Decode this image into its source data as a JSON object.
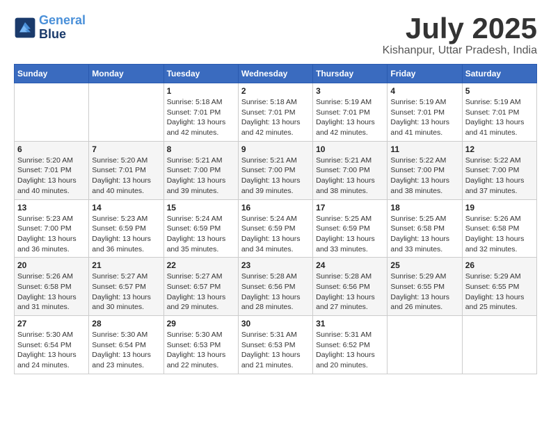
{
  "header": {
    "logo_line1": "General",
    "logo_line2": "Blue",
    "month_year": "July 2025",
    "location": "Kishanpur, Uttar Pradesh, India"
  },
  "days_of_week": [
    "Sunday",
    "Monday",
    "Tuesday",
    "Wednesday",
    "Thursday",
    "Friday",
    "Saturday"
  ],
  "weeks": [
    [
      {
        "day": "",
        "info": ""
      },
      {
        "day": "",
        "info": ""
      },
      {
        "day": "1",
        "info": "Sunrise: 5:18 AM\nSunset: 7:01 PM\nDaylight: 13 hours and 42 minutes."
      },
      {
        "day": "2",
        "info": "Sunrise: 5:18 AM\nSunset: 7:01 PM\nDaylight: 13 hours and 42 minutes."
      },
      {
        "day": "3",
        "info": "Sunrise: 5:19 AM\nSunset: 7:01 PM\nDaylight: 13 hours and 42 minutes."
      },
      {
        "day": "4",
        "info": "Sunrise: 5:19 AM\nSunset: 7:01 PM\nDaylight: 13 hours and 41 minutes."
      },
      {
        "day": "5",
        "info": "Sunrise: 5:19 AM\nSunset: 7:01 PM\nDaylight: 13 hours and 41 minutes."
      }
    ],
    [
      {
        "day": "6",
        "info": "Sunrise: 5:20 AM\nSunset: 7:01 PM\nDaylight: 13 hours and 40 minutes."
      },
      {
        "day": "7",
        "info": "Sunrise: 5:20 AM\nSunset: 7:01 PM\nDaylight: 13 hours and 40 minutes."
      },
      {
        "day": "8",
        "info": "Sunrise: 5:21 AM\nSunset: 7:00 PM\nDaylight: 13 hours and 39 minutes."
      },
      {
        "day": "9",
        "info": "Sunrise: 5:21 AM\nSunset: 7:00 PM\nDaylight: 13 hours and 39 minutes."
      },
      {
        "day": "10",
        "info": "Sunrise: 5:21 AM\nSunset: 7:00 PM\nDaylight: 13 hours and 38 minutes."
      },
      {
        "day": "11",
        "info": "Sunrise: 5:22 AM\nSunset: 7:00 PM\nDaylight: 13 hours and 38 minutes."
      },
      {
        "day": "12",
        "info": "Sunrise: 5:22 AM\nSunset: 7:00 PM\nDaylight: 13 hours and 37 minutes."
      }
    ],
    [
      {
        "day": "13",
        "info": "Sunrise: 5:23 AM\nSunset: 7:00 PM\nDaylight: 13 hours and 36 minutes."
      },
      {
        "day": "14",
        "info": "Sunrise: 5:23 AM\nSunset: 6:59 PM\nDaylight: 13 hours and 36 minutes."
      },
      {
        "day": "15",
        "info": "Sunrise: 5:24 AM\nSunset: 6:59 PM\nDaylight: 13 hours and 35 minutes."
      },
      {
        "day": "16",
        "info": "Sunrise: 5:24 AM\nSunset: 6:59 PM\nDaylight: 13 hours and 34 minutes."
      },
      {
        "day": "17",
        "info": "Sunrise: 5:25 AM\nSunset: 6:59 PM\nDaylight: 13 hours and 33 minutes."
      },
      {
        "day": "18",
        "info": "Sunrise: 5:25 AM\nSunset: 6:58 PM\nDaylight: 13 hours and 33 minutes."
      },
      {
        "day": "19",
        "info": "Sunrise: 5:26 AM\nSunset: 6:58 PM\nDaylight: 13 hours and 32 minutes."
      }
    ],
    [
      {
        "day": "20",
        "info": "Sunrise: 5:26 AM\nSunset: 6:58 PM\nDaylight: 13 hours and 31 minutes."
      },
      {
        "day": "21",
        "info": "Sunrise: 5:27 AM\nSunset: 6:57 PM\nDaylight: 13 hours and 30 minutes."
      },
      {
        "day": "22",
        "info": "Sunrise: 5:27 AM\nSunset: 6:57 PM\nDaylight: 13 hours and 29 minutes."
      },
      {
        "day": "23",
        "info": "Sunrise: 5:28 AM\nSunset: 6:56 PM\nDaylight: 13 hours and 28 minutes."
      },
      {
        "day": "24",
        "info": "Sunrise: 5:28 AM\nSunset: 6:56 PM\nDaylight: 13 hours and 27 minutes."
      },
      {
        "day": "25",
        "info": "Sunrise: 5:29 AM\nSunset: 6:55 PM\nDaylight: 13 hours and 26 minutes."
      },
      {
        "day": "26",
        "info": "Sunrise: 5:29 AM\nSunset: 6:55 PM\nDaylight: 13 hours and 25 minutes."
      }
    ],
    [
      {
        "day": "27",
        "info": "Sunrise: 5:30 AM\nSunset: 6:54 PM\nDaylight: 13 hours and 24 minutes."
      },
      {
        "day": "28",
        "info": "Sunrise: 5:30 AM\nSunset: 6:54 PM\nDaylight: 13 hours and 23 minutes."
      },
      {
        "day": "29",
        "info": "Sunrise: 5:30 AM\nSunset: 6:53 PM\nDaylight: 13 hours and 22 minutes."
      },
      {
        "day": "30",
        "info": "Sunrise: 5:31 AM\nSunset: 6:53 PM\nDaylight: 13 hours and 21 minutes."
      },
      {
        "day": "31",
        "info": "Sunrise: 5:31 AM\nSunset: 6:52 PM\nDaylight: 13 hours and 20 minutes."
      },
      {
        "day": "",
        "info": ""
      },
      {
        "day": "",
        "info": ""
      }
    ]
  ]
}
